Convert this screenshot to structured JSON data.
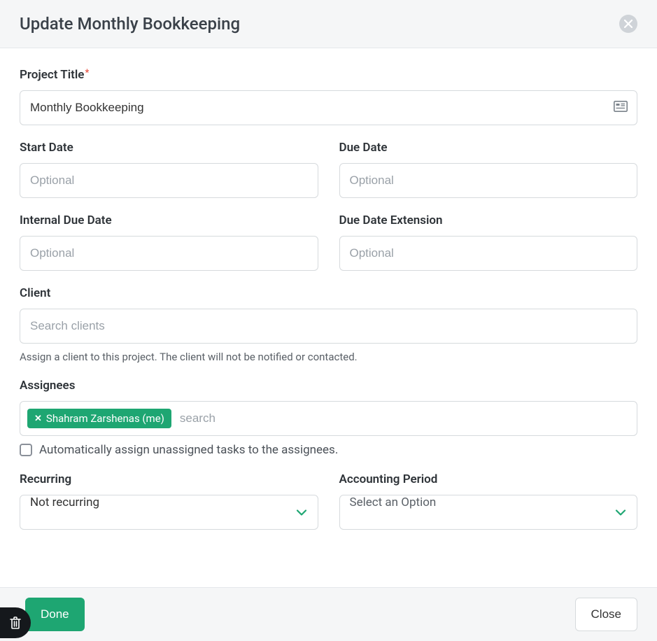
{
  "header": {
    "title": "Update Monthly Bookkeeping"
  },
  "form": {
    "project_title": {
      "label": "Project Title",
      "value": "Monthly Bookkeeping"
    },
    "start_date": {
      "label": "Start Date",
      "placeholder": "Optional"
    },
    "due_date": {
      "label": "Due Date",
      "placeholder": "Optional"
    },
    "internal_due_date": {
      "label": "Internal Due Date",
      "placeholder": "Optional"
    },
    "due_date_extension": {
      "label": "Due Date Extension",
      "placeholder": "Optional"
    },
    "client": {
      "label": "Client",
      "placeholder": "Search clients",
      "help": "Assign a client to this project. The client will not be notified or contacted."
    },
    "assignees": {
      "label": "Assignees",
      "tags": [
        "Shahram Zarshenas (me)"
      ],
      "placeholder": "search",
      "auto_assign_label": "Automatically assign unassigned tasks to the assignees."
    },
    "recurring": {
      "label": "Recurring",
      "selected": "Not recurring"
    },
    "accounting_period": {
      "label": "Accounting Period",
      "selected": "Select an Option"
    }
  },
  "footer": {
    "done": "Done",
    "close": "Close"
  }
}
